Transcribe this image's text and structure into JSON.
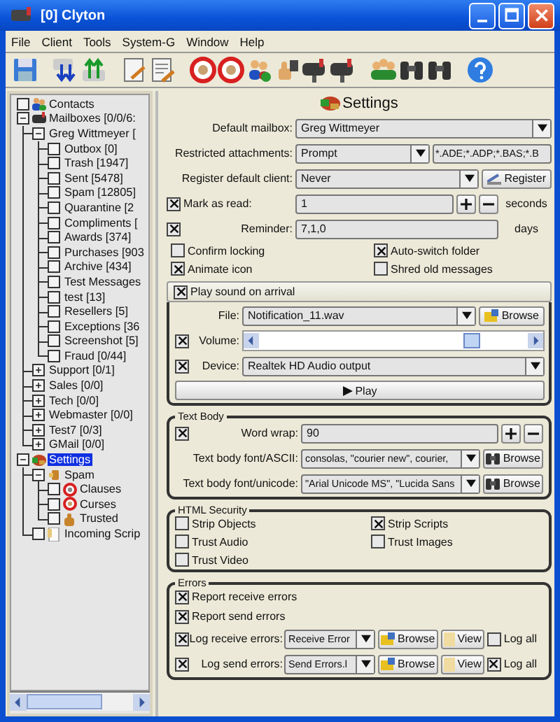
{
  "window": {
    "title": "[0] Clyton"
  },
  "menu": [
    "File",
    "Client",
    "Tools",
    "System-G",
    "Window",
    "Help"
  ],
  "tree": [
    {
      "label": "Contacts",
      "kind": "contacts",
      "checked": false,
      "selected": false
    },
    {
      "label": "Mailboxes [0/0/6:",
      "kind": "mailbox",
      "expanded": true,
      "selected": false,
      "children": [
        {
          "label": "Greg Wittmeyer [",
          "expanded": true,
          "selected": false,
          "children": [
            {
              "label": "Outbox [0]",
              "checked": false,
              "selected": false
            },
            {
              "label": "Trash [1947]",
              "checked": false,
              "selected": false
            },
            {
              "label": "Sent [5478]",
              "checked": false,
              "selected": false
            },
            {
              "label": "Spam [12805]",
              "checked": false,
              "selected": false
            },
            {
              "label": "Quarantine [2",
              "checked": false,
              "selected": false
            },
            {
              "label": "Compliments [",
              "checked": false,
              "selected": false
            },
            {
              "label": "Awards [374]",
              "checked": false,
              "selected": false
            },
            {
              "label": "Purchases [903",
              "checked": false,
              "selected": false
            },
            {
              "label": "Archive [434]",
              "checked": false,
              "selected": false
            },
            {
              "label": "Test Messages",
              "checked": false,
              "selected": false
            },
            {
              "label": "test [13]",
              "checked": false,
              "selected": false
            },
            {
              "label": "Resellers [5]",
              "checked": false,
              "selected": false
            },
            {
              "label": "Exceptions [36",
              "checked": false,
              "selected": false
            },
            {
              "label": "Screenshot [5]",
              "checked": false,
              "selected": false
            },
            {
              "label": "Fraud [0/44]",
              "checked": false,
              "selected": false
            }
          ]
        },
        {
          "label": "Support [0/1]",
          "expanded": false,
          "selected": false
        },
        {
          "label": "Sales [0/0]",
          "expanded": false,
          "selected": false
        },
        {
          "label": "Tech [0/0]",
          "expanded": false,
          "selected": false
        },
        {
          "label": "Webmaster [0/0]",
          "expanded": false,
          "selected": false
        },
        {
          "label": "Test7 [0/3]",
          "expanded": false,
          "selected": false
        },
        {
          "label": "GMail [0/0]",
          "expanded": false,
          "selected": false
        }
      ]
    },
    {
      "label": "Settings",
      "kind": "settings",
      "expanded": true,
      "selected": true,
      "children": [
        {
          "label": "Spam",
          "kind": "spam",
          "expanded": true,
          "selected": false,
          "children": [
            {
              "label": "Clauses",
              "kind": "clauses",
              "checked": false,
              "selected": false
            },
            {
              "label": "Curses",
              "kind": "curses",
              "checked": false,
              "selected": false
            },
            {
              "label": "Trusted",
              "kind": "trusted",
              "checked": false,
              "selected": false
            }
          ]
        },
        {
          "label": "Incoming Scrip",
          "kind": "script",
          "checked": false,
          "selected": false
        }
      ]
    }
  ],
  "settings": {
    "title": "Settings",
    "default_mailbox": {
      "label": "Default mailbox:",
      "value": "Greg Wittmeyer"
    },
    "restricted_attachments": {
      "label": "Restricted attachments:",
      "value": "Prompt",
      "extensions": "*.ADE;*.ADP;*.BAS;*.B"
    },
    "register_default_client": {
      "label": "Register default client:",
      "value": "Never",
      "button": "Register"
    },
    "mark_as_read": {
      "checked": true,
      "label": "Mark as read:",
      "value": "1",
      "unit": "seconds"
    },
    "reminder": {
      "checked": true,
      "label": "Reminder:",
      "value": "7,1,0",
      "unit": "days"
    },
    "options": [
      {
        "label": "Confirm locking",
        "checked": false
      },
      {
        "label": "Auto-switch folder",
        "checked": true
      },
      {
        "label": "Animate icon",
        "checked": true
      },
      {
        "label": "Shred old messages",
        "checked": false
      }
    ],
    "sound": {
      "checked": true,
      "label": "Play sound on arrival",
      "file": {
        "label": "File:",
        "value": "Notification_11.wav",
        "button": "Browse"
      },
      "volume": {
        "checked": true,
        "label": "Volume:",
        "level": 0.79
      },
      "device": {
        "checked": true,
        "label": "Device:",
        "value": "Realtek HD Audio output"
      },
      "play_button": "Play"
    }
  },
  "text_body": {
    "title": "Text Body",
    "word_wrap": {
      "checked": true,
      "label": "Word wrap:",
      "value": "90"
    },
    "fonts": [
      {
        "label": "Text body font/ASCII:",
        "value": "consolas, \"courier new\", courier,",
        "button": "Browse"
      },
      {
        "label": "Text body font/unicode:",
        "value": "\"Arial Unicode MS\", \"Lucida Sans",
        "button": "Browse"
      }
    ]
  },
  "html_security": {
    "title": "HTML Security",
    "options": [
      {
        "label": "Strip Objects",
        "checked": false
      },
      {
        "label": "Strip Scripts",
        "checked": true
      },
      {
        "label": "Trust Audio",
        "checked": false
      },
      {
        "label": "Trust Images",
        "checked": false
      },
      {
        "label": "Trust Video",
        "checked": false
      }
    ]
  },
  "errors": {
    "title": "Errors",
    "report": [
      {
        "label": "Report receive errors",
        "checked": true
      },
      {
        "label": "Report send errors",
        "checked": true
      }
    ],
    "logs": [
      {
        "checked": true,
        "label": "Log receive errors:",
        "value": "Receive Error",
        "browse": "Browse",
        "view": "View",
        "log_all": {
          "label": "Log all",
          "checked": false
        }
      },
      {
        "checked": true,
        "label": "Log send errors:",
        "value": "Send Errors.l",
        "browse": "Browse",
        "view": "View",
        "log_all": {
          "label": "Log all",
          "checked": true
        }
      }
    ]
  }
}
